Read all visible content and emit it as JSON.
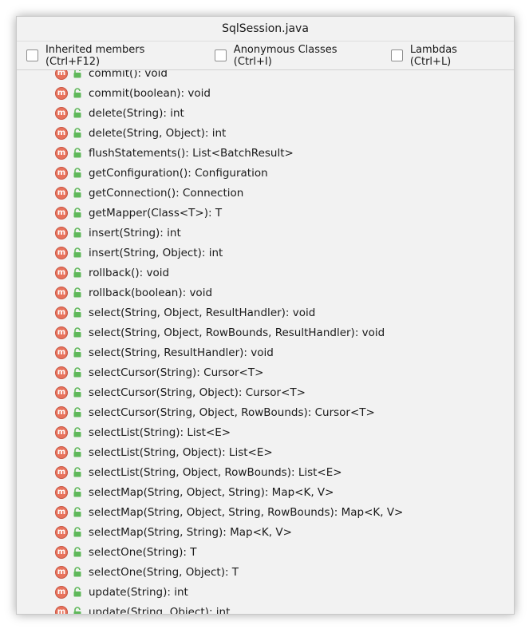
{
  "window": {
    "title": "SqlSession.java"
  },
  "options": [
    {
      "label": "Inherited members (Ctrl+F12)",
      "checked": false
    },
    {
      "label": "Anonymous Classes (Ctrl+I)",
      "checked": false
    },
    {
      "label": "Lambdas (Ctrl+L)",
      "checked": false
    }
  ],
  "icons": {
    "method": "method-icon",
    "method_letter": "m",
    "visibility": "public-lock-icon",
    "method_color": "#e8735c",
    "lock_color": "#5fb85a"
  },
  "members": [
    "commit(): void",
    "commit(boolean): void",
    "delete(String): int",
    "delete(String, Object): int",
    "flushStatements(): List<BatchResult>",
    "getConfiguration(): Configuration",
    "getConnection(): Connection",
    "getMapper(Class<T>): T",
    "insert(String): int",
    "insert(String, Object): int",
    "rollback(): void",
    "rollback(boolean): void",
    "select(String, Object, ResultHandler): void",
    "select(String, Object, RowBounds, ResultHandler): void",
    "select(String, ResultHandler): void",
    "selectCursor(String): Cursor<T>",
    "selectCursor(String, Object): Cursor<T>",
    "selectCursor(String, Object, RowBounds): Cursor<T>",
    "selectList(String): List<E>",
    "selectList(String, Object): List<E>",
    "selectList(String, Object, RowBounds): List<E>",
    "selectMap(String, Object, String): Map<K, V>",
    "selectMap(String, Object, String, RowBounds): Map<K, V>",
    "selectMap(String, String): Map<K, V>",
    "selectOne(String): T",
    "selectOne(String, Object): T",
    "update(String): int",
    "update(String, Object): int"
  ]
}
